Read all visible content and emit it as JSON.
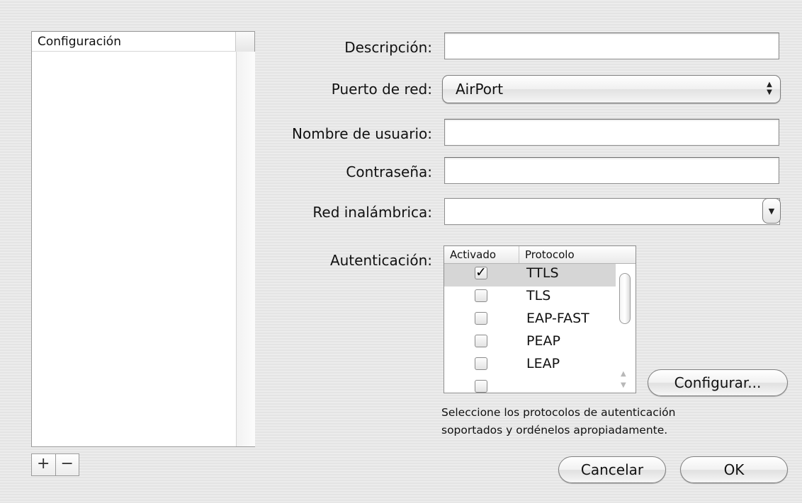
{
  "sidebar": {
    "list_header": "Configuración",
    "add_label": "+",
    "remove_label": "−"
  },
  "form": {
    "descripcion": {
      "label": "Descripción:",
      "value": ""
    },
    "puerto": {
      "label": "Puerto de red:",
      "value": "AirPort"
    },
    "usuario": {
      "label": "Nombre de usuario:",
      "value": ""
    },
    "contrasena": {
      "label": "Contraseña:",
      "value": ""
    },
    "red": {
      "label": "Red inalámbrica:",
      "value": ""
    },
    "autenticacion": {
      "label": "Autenticación:",
      "col_activado": "Activado",
      "col_protocolo": "Protocolo",
      "rows": [
        {
          "protocol": "TTLS",
          "enabled": "✓"
        },
        {
          "protocol": "TLS",
          "enabled": ""
        },
        {
          "protocol": "EAP-FAST",
          "enabled": ""
        },
        {
          "protocol": "PEAP",
          "enabled": ""
        },
        {
          "protocol": "LEAP",
          "enabled": ""
        }
      ],
      "hint_line1": "Seleccione los protocolos de autenticación",
      "hint_line2": "soportados y ordénelos apropiadamente."
    }
  },
  "buttons": {
    "configurar": "Configurar...",
    "cancelar": "Cancelar",
    "ok": "OK"
  }
}
